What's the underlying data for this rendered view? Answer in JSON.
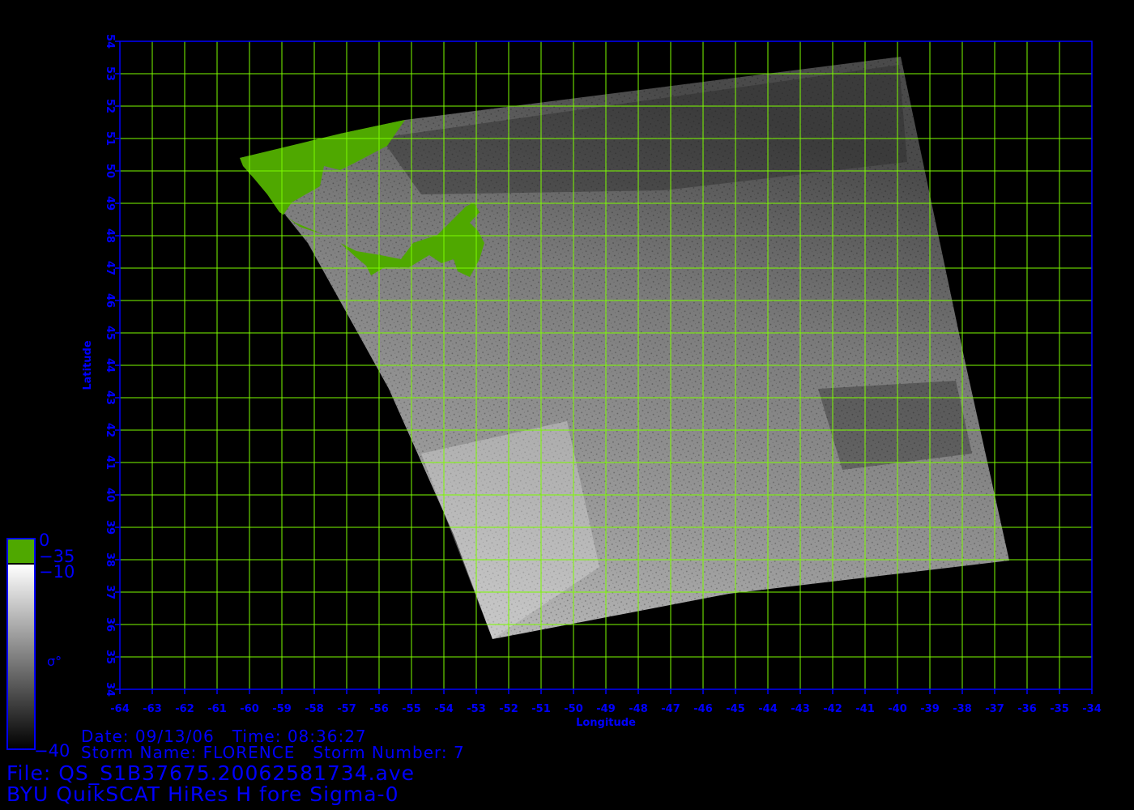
{
  "axes": {
    "x_label": "Longitude",
    "y_label": "Latitude",
    "x_ticks": [
      "-64",
      "-63",
      "-62",
      "-61",
      "-60",
      "-59",
      "-58",
      "-57",
      "-56",
      "-55",
      "-54",
      "-53",
      "-52",
      "-51",
      "-50",
      "-49",
      "-48",
      "-47",
      "-46",
      "-45",
      "-44",
      "-43",
      "-42",
      "-41",
      "-40",
      "-39",
      "-38",
      "-37",
      "-36",
      "-35",
      "-34"
    ],
    "y_ticks": [
      "54",
      "53",
      "52",
      "51",
      "50",
      "49",
      "48",
      "47",
      "46",
      "45",
      "44",
      "43",
      "42",
      "41",
      "40",
      "39",
      "38",
      "37",
      "36",
      "35",
      "34"
    ],
    "x_range": [
      -64,
      -34
    ],
    "y_range": [
      34,
      54
    ],
    "grid": true
  },
  "colorbar": {
    "labels": {
      "top": "0",
      "land_threshold": "−35",
      "upper": "−10",
      "bottom": "−40",
      "units": "σ°"
    },
    "land_color": "#4fa800",
    "gradient_top": "#ffffff",
    "gradient_bottom": "#000000"
  },
  "info": {
    "date_line": "Date: 09/13/06   Time: 08:36:27",
    "storm_line": "Storm Name: FLORENCE   Storm Number: 7",
    "file_line": "File: QS_S1B37675.20062581734.ave",
    "title_line": "BYU QuikSCAT HiRes H fore Sigma-0"
  },
  "colors": {
    "grid": "#7cfc00",
    "axis": "#0000ff",
    "land": "#4fa800",
    "background": "#000000"
  }
}
